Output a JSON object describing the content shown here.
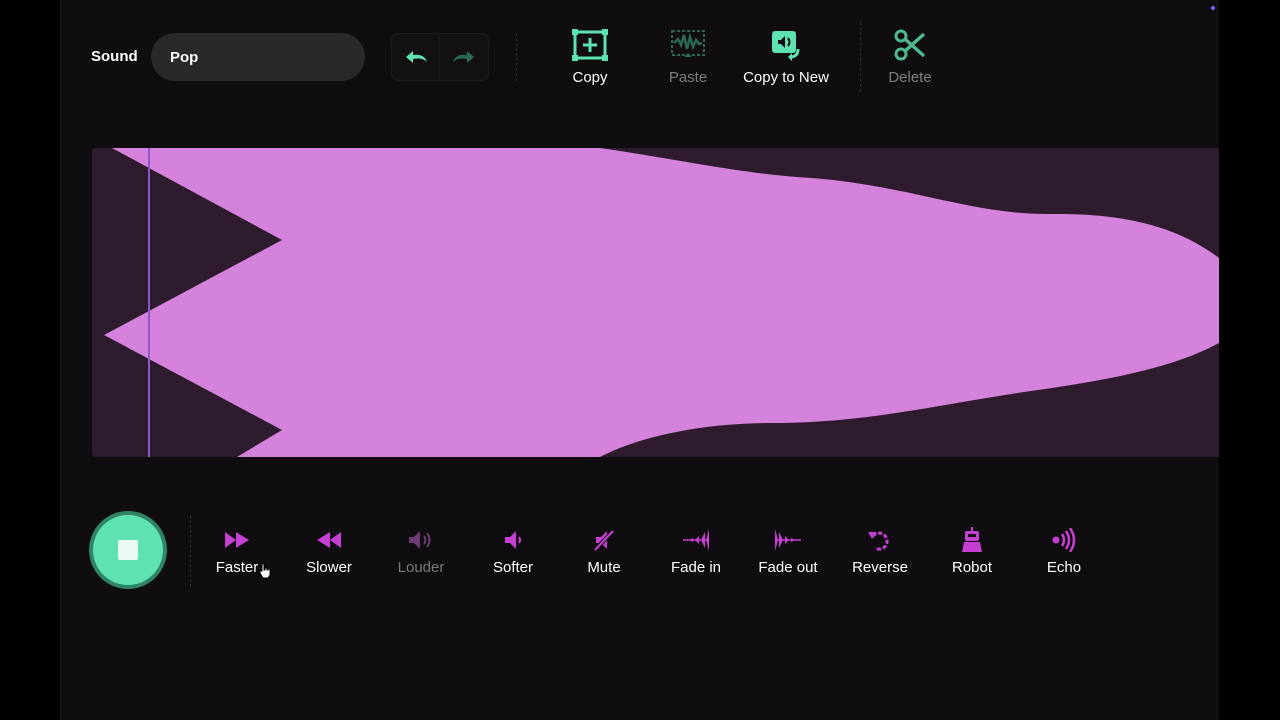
{
  "sound": {
    "label": "Sound",
    "name": "Pop"
  },
  "history": {
    "undo_icon": "undo-icon",
    "redo_icon": "redo-icon"
  },
  "toolbar": {
    "copy_label": "Copy",
    "paste_label": "Paste",
    "copy_to_new_label": "Copy to New",
    "delete_label": "Delete"
  },
  "playback": {
    "state": "playing",
    "icon": "stop-icon"
  },
  "effects": {
    "faster": "Faster",
    "slower": "Slower",
    "louder": "Louder",
    "softer": "Softer",
    "mute": "Mute",
    "fade_in": "Fade in",
    "fade_out": "Fade out",
    "reverse": "Reverse",
    "robot": "Robot",
    "echo": "Echo"
  },
  "colors": {
    "accent": "#5ee3b0",
    "waveform": "#d582dd",
    "waveform_bg": "#2e1c2e",
    "effect_icon": "#c63fd3",
    "playhead": "#8c57c8"
  }
}
